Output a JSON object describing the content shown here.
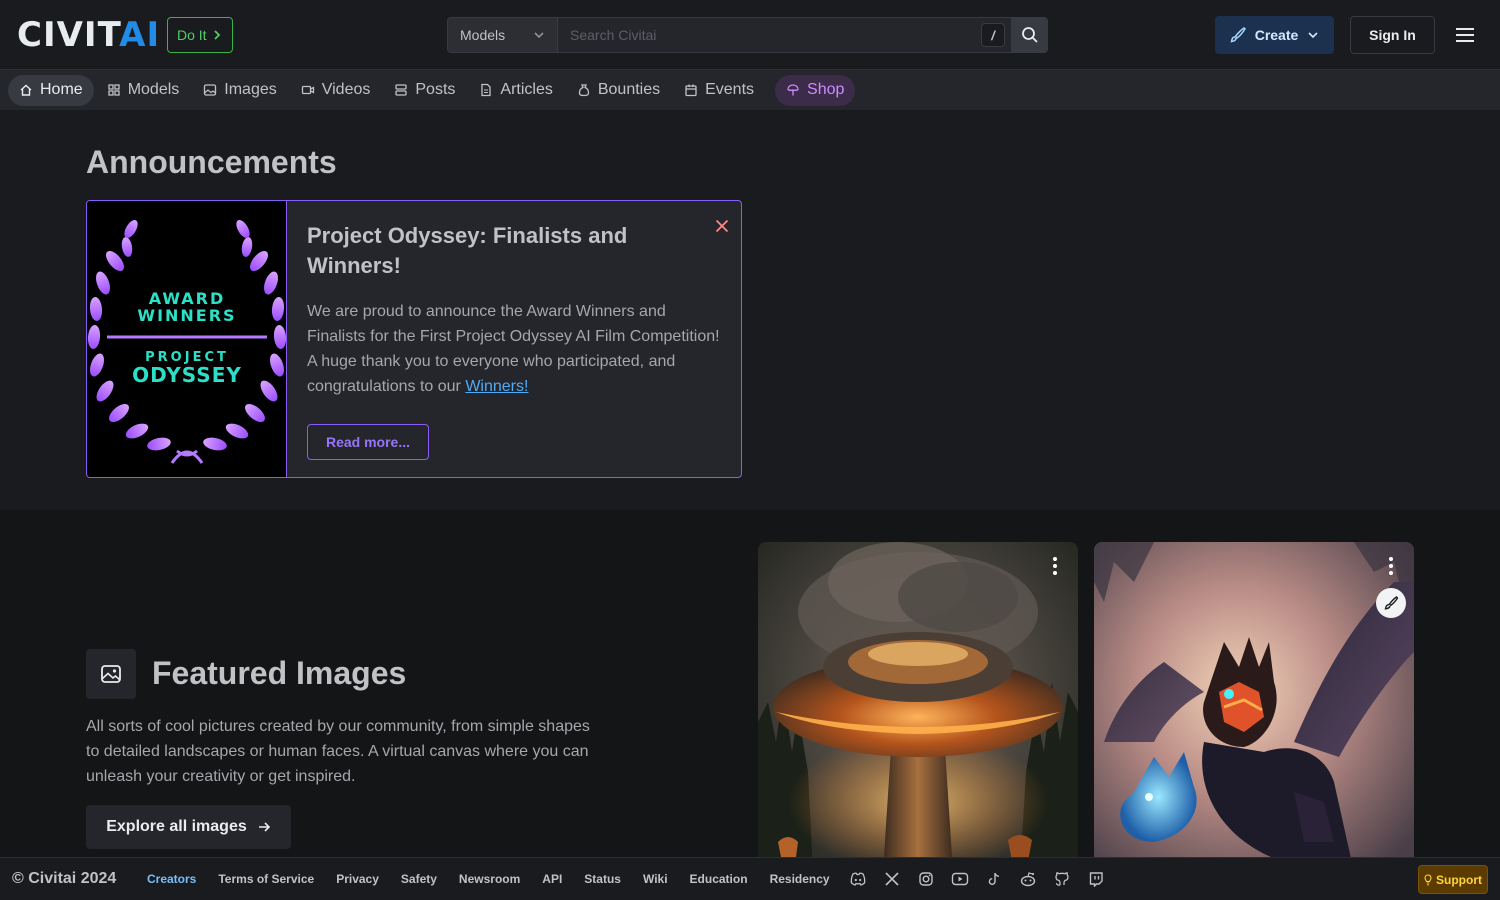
{
  "header": {
    "logo": {
      "part1": "CIVIT",
      "part2": "AI"
    },
    "doit_label": "Do It",
    "search": {
      "scope": "Models",
      "placeholder": "Search Civitai",
      "shortcut": "/"
    },
    "create_label": "Create",
    "signin_label": "Sign In"
  },
  "nav": {
    "items": [
      {
        "label": "Home",
        "icon": "home-icon"
      },
      {
        "label": "Models",
        "icon": "grid-icon"
      },
      {
        "label": "Images",
        "icon": "image-icon"
      },
      {
        "label": "Videos",
        "icon": "video-icon"
      },
      {
        "label": "Posts",
        "icon": "posts-icon"
      },
      {
        "label": "Articles",
        "icon": "article-icon"
      },
      {
        "label": "Bounties",
        "icon": "moneybag-icon"
      },
      {
        "label": "Events",
        "icon": "calendar-icon"
      },
      {
        "label": "Shop",
        "icon": "shop-icon"
      }
    ]
  },
  "announcements": {
    "heading": "Announcements",
    "card": {
      "image_text": {
        "line1": "AWARD",
        "line2": "WINNERS",
        "line3": "PROJECT",
        "line4": "ODYSSEY"
      },
      "title": "Project Odyssey: Finalists and Winners!",
      "body": "We are proud to announce the Award Winners and Finalists for the First Project Odyssey AI Film Competition! A huge thank you to everyone who participated, and congratulations to our ",
      "link_text": "Winners!",
      "read_more": "Read more..."
    }
  },
  "featured": {
    "title": "Featured Images",
    "description": "All sorts of cool pictures created by our community, from simple shapes to detailed landscapes or human faces. A virtual canvas where you can unleash your creativity or get inspired.",
    "explore_label": "Explore all images"
  },
  "footer": {
    "copyright": "© Civitai 2024",
    "links": [
      "Creators",
      "Terms of Service",
      "Privacy",
      "Safety",
      "Newsroom",
      "API",
      "Status",
      "Wiki",
      "Education",
      "Residency"
    ],
    "social": [
      "discord-icon",
      "x-icon",
      "instagram-icon",
      "youtube-icon",
      "tiktok-icon",
      "reddit-icon",
      "github-icon",
      "twitch-icon"
    ],
    "support_label": "Support"
  },
  "colors": {
    "accent": "#228be6",
    "purple": "#8a5cf6",
    "green": "#51cf66",
    "support": "#ffd43b"
  }
}
